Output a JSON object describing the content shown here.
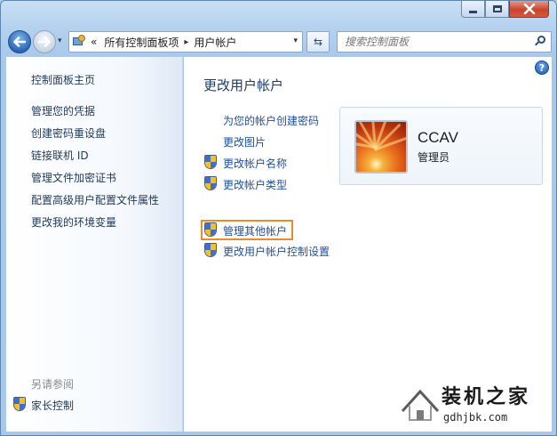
{
  "window": {
    "caption_buttons": [
      "minimize",
      "maximize",
      "close"
    ]
  },
  "nav": {
    "back_glyph": "◀",
    "forward_glyph": "▶",
    "history_glyph": "▾",
    "address": {
      "prefix": "«",
      "crumbs": [
        "所有控制面板项",
        "用户帐户"
      ],
      "separator": "▸",
      "dropdown_glyph": "▾"
    },
    "refresh_glyph": "⇆",
    "search": {
      "placeholder": "搜索控制面板",
      "value": ""
    }
  },
  "sidebar": {
    "home": "控制面板主页",
    "items": [
      "管理您的凭据",
      "创建密码重设盘",
      "链接联机 ID",
      "管理文件加密证书",
      "配置高级用户配置文件属性",
      "更改我的环境变量"
    ],
    "see_also_heading": "另请参阅",
    "see_also": [
      {
        "label": "家长控制",
        "icon": "uac-shield-icon"
      }
    ]
  },
  "main": {
    "help_glyph": "?",
    "title": "更改用户帐户",
    "tasks": [
      {
        "label": "为您的帐户创建密码",
        "shield": false
      },
      {
        "label": "更改图片",
        "shield": false
      },
      {
        "label": "更改帐户名称",
        "shield": true
      },
      {
        "label": "更改帐户类型",
        "shield": true
      }
    ],
    "other_tasks": [
      {
        "label": "管理其他帐户",
        "shield": true,
        "highlighted": true
      },
      {
        "label": "更改用户帐户控制设置",
        "shield": true
      }
    ],
    "user": {
      "name": "CCAV",
      "role": "管理员"
    }
  },
  "watermark": {
    "title": "装机之家",
    "url": "gdhjbk.com"
  },
  "colors": {
    "link": "#1f4f9c",
    "sidebar_link": "#1e395b",
    "title": "#1d3c6e",
    "highlight_border": "#ec8a2c",
    "close_button": "#c9452c"
  }
}
